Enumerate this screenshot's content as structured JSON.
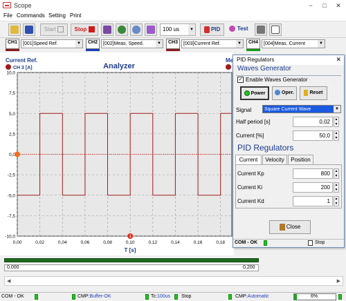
{
  "app": {
    "title": "Scope",
    "window_controls": [
      "−",
      "□",
      "✕"
    ]
  },
  "menu": [
    "File",
    "Commands",
    "Setting",
    "Print"
  ],
  "toolbar": {
    "start": "Start",
    "stop": "Stop",
    "timebase": "100 us",
    "pid": "PID",
    "test": "Test"
  },
  "channels": [
    {
      "label": "CH1",
      "value": "[001]Speed Ref.",
      "color": "#8b1a1a"
    },
    {
      "label": "CH2",
      "value": "[002]Meas. Speed.",
      "color": "#1a3cb8"
    },
    {
      "label": "CH3",
      "value": "[003]Current Ref.",
      "color": "#8b1a1a"
    },
    {
      "label": "CH4",
      "value": "[004]Meas. Current",
      "color": "#159a15"
    }
  ],
  "plot": {
    "title": "Analyzer",
    "legend_left_top": "Current Ref.",
    "legend_left_bottom": "CH 3 [A]",
    "legend_right": "Me",
    "xlabel": "T [s]",
    "marker_label": "1"
  },
  "chart_data": {
    "type": "line",
    "title": "Analyzer",
    "xlabel": "T [s]",
    "ylabel": "CH 3 [A]",
    "xlim": [
      0.0,
      0.19
    ],
    "ylim": [
      -10.0,
      10.0
    ],
    "xticks": [
      "0,00",
      "0,02",
      "0,04",
      "0,06",
      "0,08",
      "0,10",
      "0,12",
      "0,14",
      "0,16",
      "0,18"
    ],
    "yticks": [
      "10,0",
      "7,5",
      "5,0",
      "2,5",
      "0,0",
      "-2,5",
      "-5,0",
      "-7,5",
      "-10,0"
    ],
    "series": [
      {
        "name": "Current Ref.",
        "color": "#a01a1a",
        "x": [
          0.0,
          0.02,
          0.02,
          0.04,
          0.04,
          0.06,
          0.06,
          0.08,
          0.08,
          0.1,
          0.1,
          0.12,
          0.12,
          0.14,
          0.14,
          0.16,
          0.16,
          0.18,
          0.18,
          0.19
        ],
        "y": [
          -5.0,
          -5.0,
          5.0,
          5.0,
          -5.0,
          -5.0,
          5.0,
          5.0,
          -5.0,
          -5.0,
          5.0,
          5.0,
          -5.0,
          -5.0,
          5.0,
          5.0,
          -5.0,
          -5.0,
          5.0,
          5.0
        ]
      },
      {
        "name": "Meas. Current",
        "color": "#e03030",
        "x": [
          0.0,
          0.19
        ],
        "y": [
          0.0,
          0.0
        ]
      }
    ]
  },
  "scroll": {
    "left": "0,000",
    "right": "0,200"
  },
  "status": {
    "com": "COM - OK",
    "cmp": "CMP:",
    "buffer": "Buffer-OK",
    "tc_label": "Tc:",
    "tc_value": "100us",
    "stop": "Stop",
    "cmp2": "CMP:",
    "automatic": "Automatic",
    "pct": "6%"
  },
  "dialog": {
    "title": "PID Regulators",
    "waves_header": "Waves Generator",
    "enable_label": "Enable Waves Generator",
    "enable_checked": true,
    "power": "Power",
    "oper": "Oper.",
    "reset": "Reset",
    "signal_label": "Signal",
    "signal_value": "Square Current Wave",
    "half_label": "Half period [s]",
    "half_value": "0,02",
    "current_label": "Current [%]",
    "current_value": "50,0",
    "pid_header": "PID Regulators",
    "tabs": [
      "Current",
      "Velocity",
      "Position"
    ],
    "kp_label": "Current Kp",
    "kp_value": "800",
    "ki_label": "Current Ki",
    "ki_value": "200",
    "kd_label": "Current Kd",
    "kd_value": "1",
    "close": "Close",
    "status_com": "COM - OK",
    "status_stop": "Stop"
  }
}
